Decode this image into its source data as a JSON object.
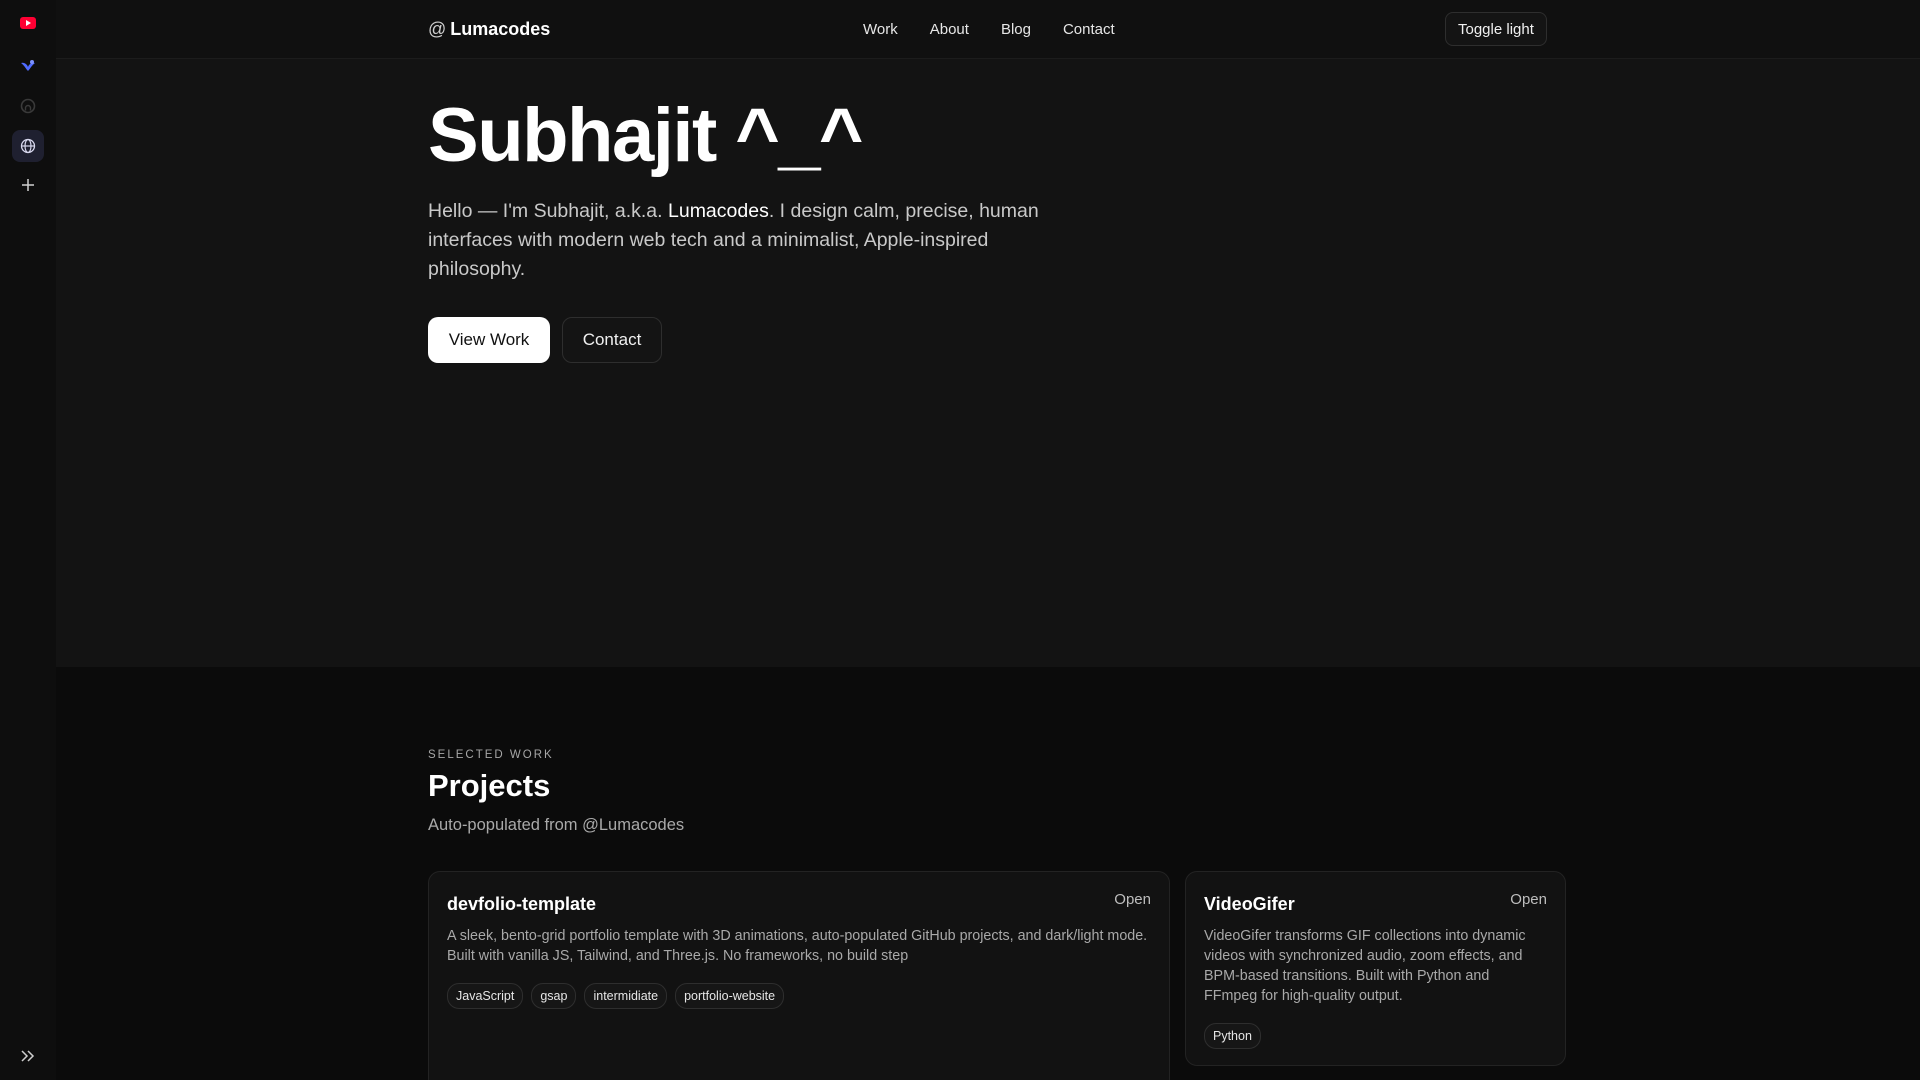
{
  "dock": {
    "items": [
      {
        "name": "youtube-icon",
        "color": "#ff0033"
      },
      {
        "name": "bird-icon",
        "color": "#4f6bff"
      },
      {
        "name": "github-icon",
        "color": "#333333"
      },
      {
        "name": "globe-icon",
        "color": "#cfcfe8"
      },
      {
        "name": "plus-icon",
        "color": "#cfcfcf"
      }
    ],
    "expand_icon": "chevrons-right-icon"
  },
  "nav": {
    "brand_at": "@",
    "brand": "Lumacodes",
    "links": [
      "Work",
      "About",
      "Blog",
      "Contact"
    ],
    "toggle_label": "Toggle light"
  },
  "hero": {
    "title": "Subhajit ^_^",
    "intro_before": "Hello — I'm Subhajit, a.k.a. ",
    "intro_highlight": "Lumacodes",
    "intro_after": ". I design calm, precise, human interfaces with modern web tech and a minimalist, Apple-inspired philosophy.",
    "primary_button": "View Work",
    "secondary_button": "Contact"
  },
  "projects": {
    "eyebrow": "SELECTED WORK",
    "title": "Projects",
    "subtitle": "Auto-populated from @Lumacodes",
    "cards": [
      {
        "title": "devfolio-template",
        "open_label": "Open",
        "description": "A sleek, bento-grid portfolio template with 3D animations, auto-populated GitHub projects, and dark/light mode. Built with vanilla JS, Tailwind, and Three.js. No frameworks, no build step",
        "tags": [
          "JavaScript",
          "gsap",
          "intermidiate",
          "portfolio-website"
        ]
      },
      {
        "title": "VideoGifer",
        "open_label": "Open",
        "description": "VideoGifer transforms GIF collections into dynamic videos with synchronized audio, zoom effects, and BPM-based transitions. Built with Python and FFmpeg for high-quality output.",
        "tags": [
          "Python"
        ]
      }
    ]
  },
  "colors": {
    "page_bg": "#0b0b0b",
    "hero_bg": "#131313",
    "text": "#f2f2f2",
    "muted": "#a9a9a9"
  }
}
